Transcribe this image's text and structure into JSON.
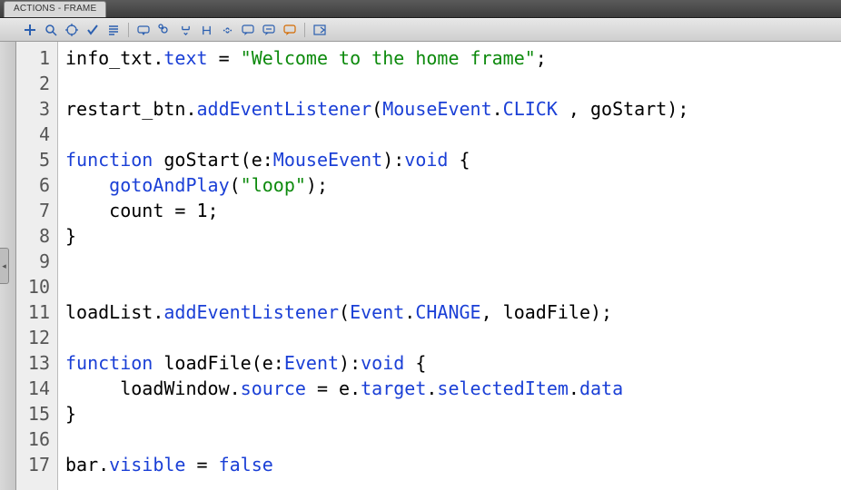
{
  "panel": {
    "tab_label": "ACTIONS - FRAME"
  },
  "toolbar": {
    "icons": [
      "add-script-icon",
      "find-icon",
      "target-icon",
      "check-syntax-icon",
      "auto-format-icon",
      "code-hint-icon",
      "debug-icon",
      "collapse-selection-icon",
      "collapse-between-icon",
      "expand-all-icon",
      "comment-icon",
      "uncomment-icon",
      "remove-comment-icon",
      "show-hide-icon"
    ]
  },
  "code": {
    "lines": [
      {
        "n": "1",
        "tokens": [
          [
            "info_txt",
            "black"
          ],
          [
            ".",
            "black"
          ],
          [
            "text",
            "blue"
          ],
          [
            " = ",
            "black"
          ],
          [
            "\"Welcome to the home frame\"",
            "green"
          ],
          [
            ";",
            "black"
          ]
        ]
      },
      {
        "n": "2",
        "tokens": []
      },
      {
        "n": "3",
        "tokens": [
          [
            "restart_btn.",
            "black"
          ],
          [
            "addEventListener",
            "blue"
          ],
          [
            "(",
            "black"
          ],
          [
            "MouseEvent",
            "blue"
          ],
          [
            ".",
            "black"
          ],
          [
            "CLICK",
            "blue"
          ],
          [
            " , goStart);",
            "black"
          ]
        ]
      },
      {
        "n": "4",
        "tokens": []
      },
      {
        "n": "5",
        "tokens": [
          [
            "function",
            "blue"
          ],
          [
            " goStart(e:",
            "black"
          ],
          [
            "MouseEvent",
            "blue"
          ],
          [
            "):",
            "black"
          ],
          [
            "void",
            "blue"
          ],
          [
            " {",
            "black"
          ]
        ]
      },
      {
        "n": "6",
        "tokens": [
          [
            "    ",
            "black"
          ],
          [
            "gotoAndPlay",
            "blue"
          ],
          [
            "(",
            "black"
          ],
          [
            "\"loop\"",
            "green"
          ],
          [
            ");",
            "black"
          ]
        ]
      },
      {
        "n": "7",
        "tokens": [
          [
            "    count = ",
            "black"
          ],
          [
            "1",
            "black"
          ],
          [
            ";",
            "black"
          ]
        ]
      },
      {
        "n": "8",
        "tokens": [
          [
            "}",
            "black"
          ]
        ]
      },
      {
        "n": "9",
        "tokens": []
      },
      {
        "n": "10",
        "tokens": []
      },
      {
        "n": "11",
        "tokens": [
          [
            "loadList.",
            "black"
          ],
          [
            "addEventListener",
            "blue"
          ],
          [
            "(",
            "black"
          ],
          [
            "Event",
            "blue"
          ],
          [
            ".",
            "black"
          ],
          [
            "CHANGE",
            "blue"
          ],
          [
            ", loadFile);",
            "black"
          ]
        ]
      },
      {
        "n": "12",
        "tokens": []
      },
      {
        "n": "13",
        "tokens": [
          [
            "function",
            "blue"
          ],
          [
            " loadFile(e:",
            "black"
          ],
          [
            "Event",
            "blue"
          ],
          [
            "):",
            "black"
          ],
          [
            "void",
            "blue"
          ],
          [
            " {",
            "black"
          ]
        ]
      },
      {
        "n": "14",
        "tokens": [
          [
            "     loadWindow.",
            "black"
          ],
          [
            "source",
            "blue"
          ],
          [
            " = e.",
            "black"
          ],
          [
            "target",
            "blue"
          ],
          [
            ".",
            "black"
          ],
          [
            "selectedItem",
            "blue"
          ],
          [
            ".",
            "black"
          ],
          [
            "data",
            "blue"
          ]
        ]
      },
      {
        "n": "15",
        "tokens": [
          [
            "}",
            "black"
          ]
        ]
      },
      {
        "n": "16",
        "tokens": []
      },
      {
        "n": "17",
        "tokens": [
          [
            "bar.",
            "black"
          ],
          [
            "visible",
            "blue"
          ],
          [
            " = ",
            "black"
          ],
          [
            "false",
            "blue"
          ]
        ]
      }
    ]
  }
}
